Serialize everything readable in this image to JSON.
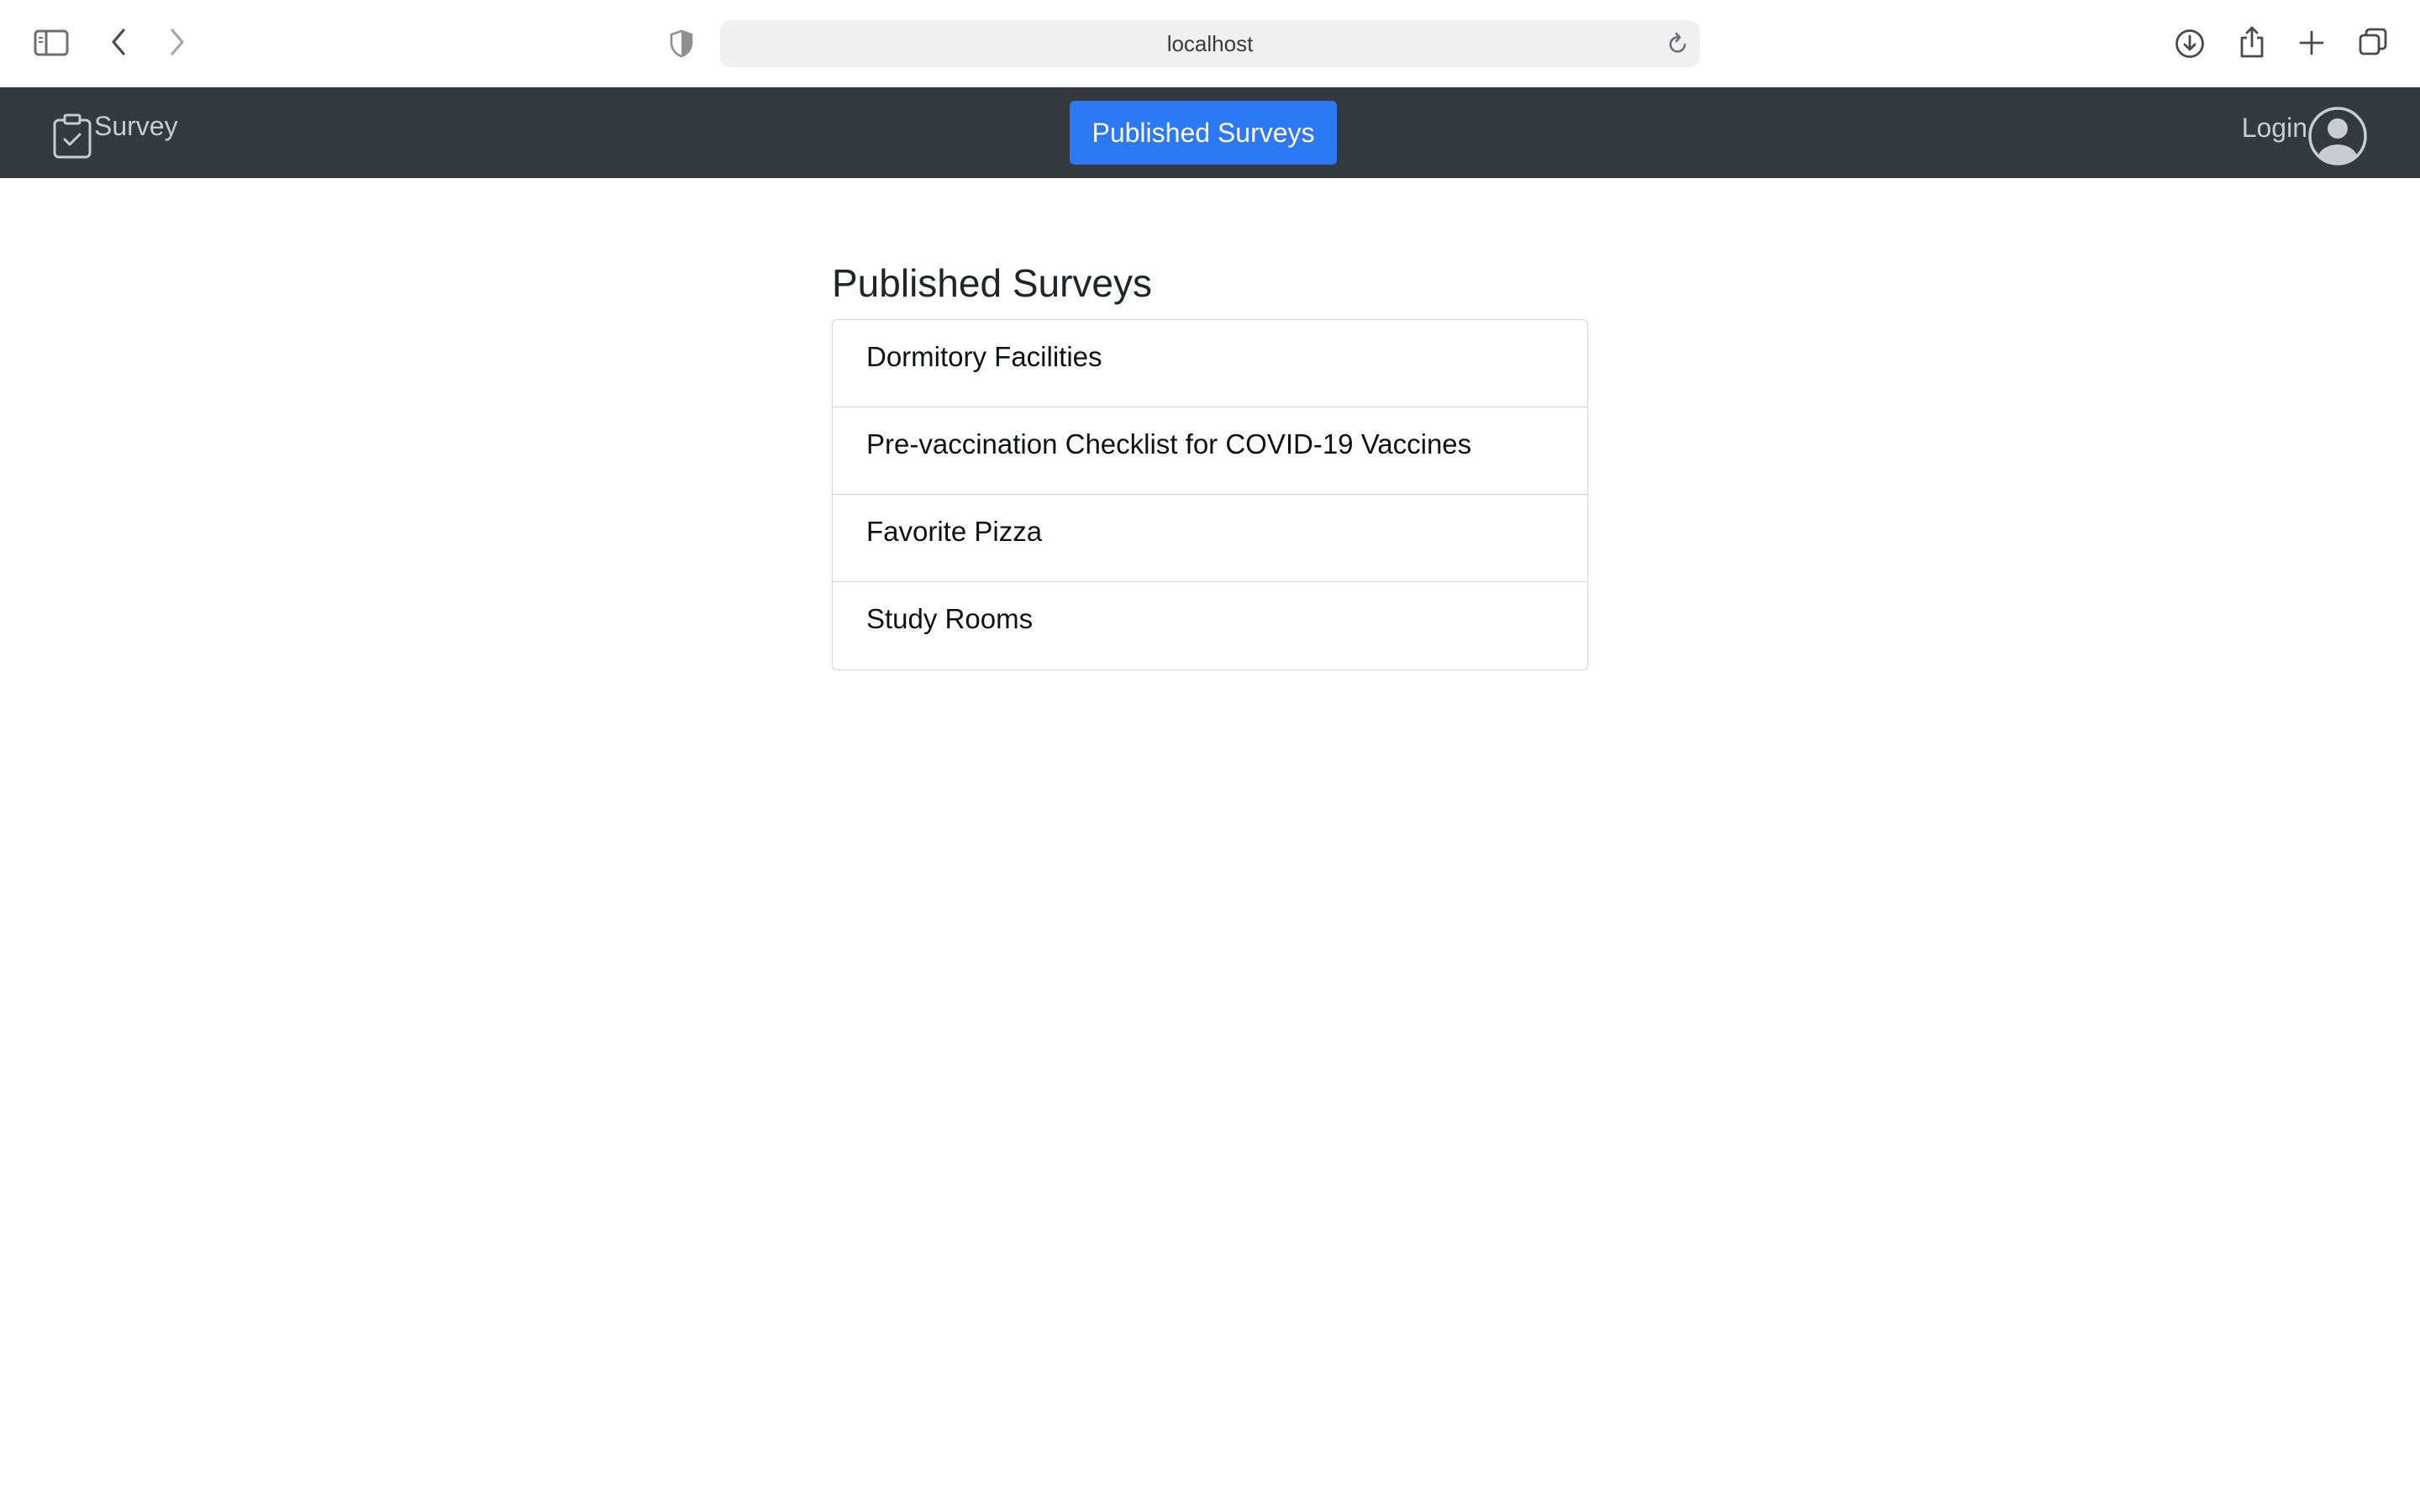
{
  "browser": {
    "url": "localhost",
    "icons": {
      "sidebar": "sidebar-toggle-icon",
      "back": "chevron-left-icon",
      "forward": "chevron-right-icon",
      "privacy": "shield-icon",
      "reload": "reload-icon",
      "download": "download-icon",
      "share": "share-icon",
      "new_tab": "plus-icon",
      "tabs": "tabs-overview-icon"
    }
  },
  "navbar": {
    "brand_label": "Survey",
    "brand_icon": "clipboard-check-icon",
    "center_button_label": "Published Surveys",
    "login_label": "Login",
    "avatar_icon": "user-circle-icon",
    "colors": {
      "background": "#343a40",
      "button": "#2d78f4"
    }
  },
  "main": {
    "title": "Published Surveys",
    "surveys": [
      {
        "label": "Dormitory Facilities"
      },
      {
        "label": "Pre-vaccination Checklist for COVID-19 Vaccines"
      },
      {
        "label": "Favorite Pizza"
      },
      {
        "label": "Study Rooms"
      }
    ]
  }
}
